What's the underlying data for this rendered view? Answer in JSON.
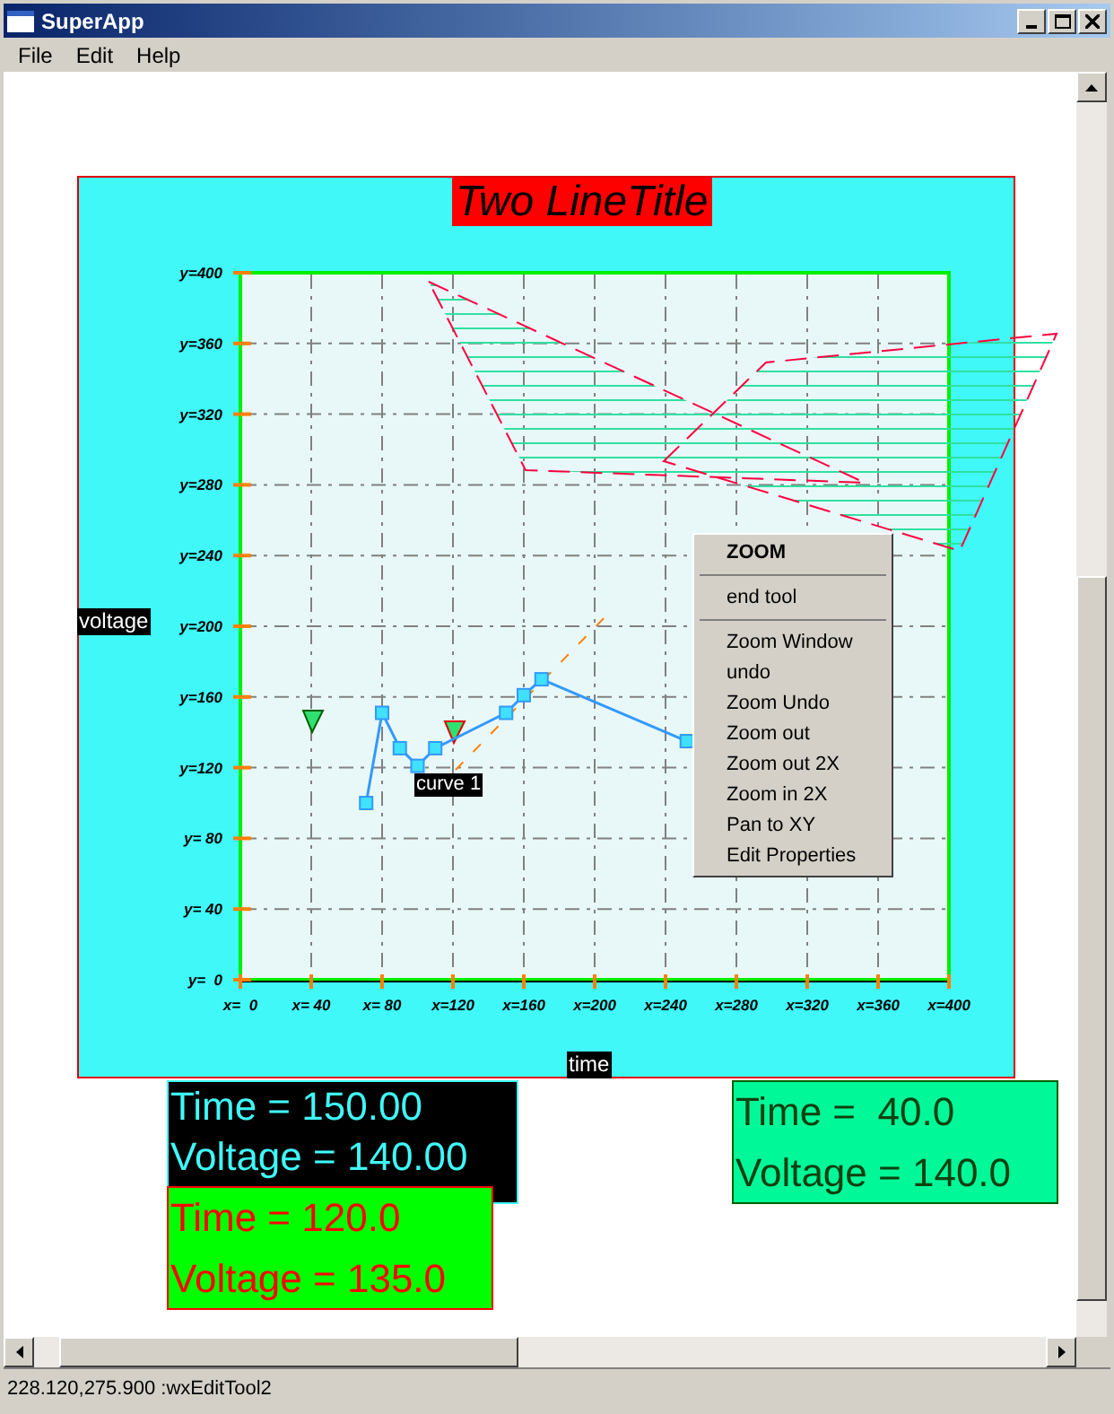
{
  "window": {
    "title": "SuperApp"
  },
  "menu_bar": [
    "File",
    "Edit",
    "Help"
  ],
  "plot": {
    "title": "Two LineTitle",
    "chart_data": {
      "type": "line",
      "grid": true,
      "xlabel": "time",
      "ylabel": "voltage",
      "xlim": [
        0,
        400
      ],
      "ylim": [
        0,
        400
      ],
      "xticks": [
        {
          "value": 0,
          "label": "x=  0"
        },
        {
          "value": 40,
          "label": "x= 40"
        },
        {
          "value": 80,
          "label": "x= 80"
        },
        {
          "value": 120,
          "label": "x=120"
        },
        {
          "value": 160,
          "label": "x=160"
        },
        {
          "value": 200,
          "label": "x=200"
        },
        {
          "value": 240,
          "label": "x=240"
        },
        {
          "value": 280,
          "label": "x=280"
        },
        {
          "value": 320,
          "label": "x=320"
        },
        {
          "value": 360,
          "label": "x=360"
        },
        {
          "value": 400,
          "label": "x=400"
        }
      ],
      "yticks": [
        {
          "value": 0,
          "label": "y=  0"
        },
        {
          "value": 40,
          "label": "y= 40"
        },
        {
          "value": 80,
          "label": "y= 80"
        },
        {
          "value": 120,
          "label": "y=120"
        },
        {
          "value": 160,
          "label": "y=160"
        },
        {
          "value": 200,
          "label": "y=200"
        },
        {
          "value": 240,
          "label": "y=240"
        },
        {
          "value": 280,
          "label": "y=280"
        },
        {
          "value": 320,
          "label": "y=320"
        },
        {
          "value": 360,
          "label": "y=360"
        },
        {
          "value": 400,
          "label": "y=400"
        }
      ],
      "x": [
        71,
        80,
        90,
        100,
        110,
        150,
        160,
        170,
        252
      ],
      "series": [
        {
          "name": "curve 1",
          "color": "#3399ff",
          "marker": "square",
          "values": [
            100,
            151,
            131,
            121,
            131,
            151,
            161,
            170,
            135
          ]
        }
      ]
    }
  },
  "context_menu": [
    {
      "kind": "header",
      "label": "ZOOM"
    },
    {
      "kind": "separator"
    },
    {
      "kind": "item",
      "label": "end tool"
    },
    {
      "kind": "separator"
    },
    {
      "kind": "item",
      "label": "Zoom Window"
    },
    {
      "kind": "item",
      "label": "undo"
    },
    {
      "kind": "item",
      "label": "Zoom Undo"
    },
    {
      "kind": "item",
      "label": "Zoom out"
    },
    {
      "kind": "item",
      "label": "Zoom out 2X"
    },
    {
      "kind": "item",
      "label": "Zoom in 2X"
    },
    {
      "kind": "item",
      "label": "Pan to XY"
    },
    {
      "kind": "item",
      "label": "Edit Properties"
    }
  ],
  "readouts": [
    {
      "kind": "dark",
      "lines": [
        "Time = 150.00",
        "Voltage = 140.00"
      ]
    },
    {
      "kind": "mint",
      "lines": [
        "Time =  40.0",
        "Voltage = 140.0"
      ]
    },
    {
      "kind": "green",
      "lines": [
        "Time = 120.0",
        "Voltage = 135.0"
      ]
    }
  ],
  "status_bar": "228.120,275.900 :wxEditTool2"
}
